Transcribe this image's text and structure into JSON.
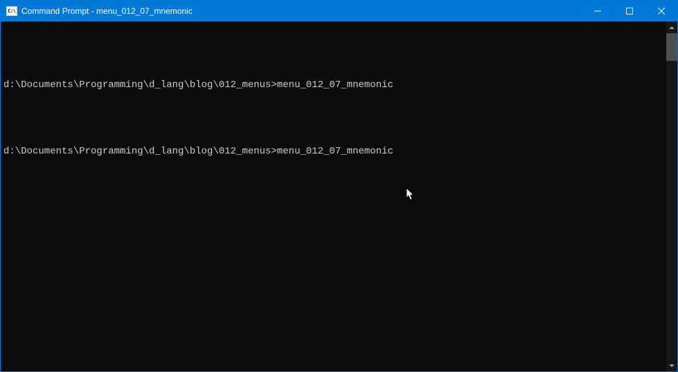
{
  "titlebar": {
    "icon_label": "C:\\",
    "title": "Command Prompt - menu_012_07_mnemonic",
    "minimize_icon": "minimize-icon",
    "maximize_icon": "maximize-icon",
    "close_icon": "close-icon"
  },
  "terminal": {
    "lines": [
      "",
      "d:\\Documents\\Programming\\d_lang\\blog\\012_menus>menu_012_07_mnemonic",
      "",
      "d:\\Documents\\Programming\\d_lang\\blog\\012_menus>menu_012_07_mnemonic"
    ]
  },
  "colors": {
    "titlebar_bg": "#0078d7",
    "terminal_bg": "#0c0c0c",
    "terminal_fg": "#cccccc"
  }
}
